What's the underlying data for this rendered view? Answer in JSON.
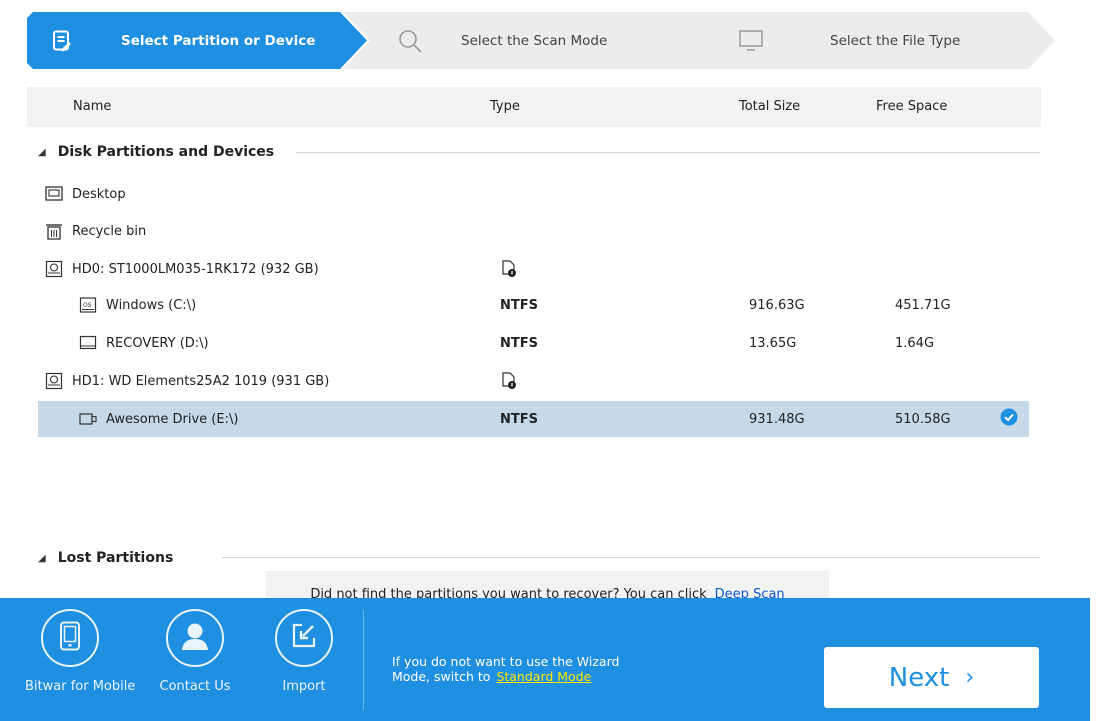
{
  "steps": [
    {
      "label": "Select Partition or Device",
      "icon": "document-edit-icon",
      "active": true
    },
    {
      "label": "Select the Scan Mode",
      "icon": "search-icon",
      "active": false
    },
    {
      "label": "Select the File Type",
      "icon": "monitor-icon",
      "active": false
    }
  ],
  "columns": {
    "name": "Name",
    "type": "Type",
    "total": "Total Size",
    "free": "Free Space"
  },
  "sections": {
    "disk": "Disk Partitions and Devices",
    "lost": "Lost Partitions"
  },
  "rows": [
    {
      "name": "Desktop",
      "type": "",
      "total": "",
      "free": "",
      "icon": "desktop-icon"
    },
    {
      "name": "Recycle bin",
      "type": "",
      "total": "",
      "free": "",
      "icon": "recycle-bin-icon"
    },
    {
      "name": "HD0: ST1000LM035-1RK172 (932 GB)",
      "type": "",
      "total": "",
      "free": "",
      "icon": "hard-disk-icon"
    },
    {
      "name": "Windows (C:\\)",
      "type": "NTFS",
      "total": "916.63G",
      "free": "451.71G",
      "icon": "os-drive-icon"
    },
    {
      "name": "RECOVERY (D:\\)",
      "type": "NTFS",
      "total": "13.65G",
      "free": "1.64G",
      "icon": "drive-icon"
    },
    {
      "name": "HD1: WD Elements25A2 1019 (931 GB)",
      "type": "",
      "total": "",
      "free": "",
      "icon": "hard-disk-icon"
    },
    {
      "name": "Awesome Drive (E:\\)",
      "type": "NTFS",
      "total": "931.48G",
      "free": "510.58G",
      "icon": "usb-drive-icon",
      "selected": true
    }
  ],
  "hint": {
    "text": "Did not find the partitions you want to recover? You can click",
    "link": "Deep Scan"
  },
  "footer": {
    "mobile": "Bitwar for Mobile",
    "contact": "Contact Us",
    "import": "Import",
    "msg_line1": "If you do not want to use the Wizard",
    "msg_line2": "Mode, switch to",
    "msg_link": "Standard Mode",
    "next": "Next"
  },
  "colors": {
    "accent": "#1e8fe1",
    "selected_row": "#c5d9e8",
    "link": "#ffe600"
  }
}
